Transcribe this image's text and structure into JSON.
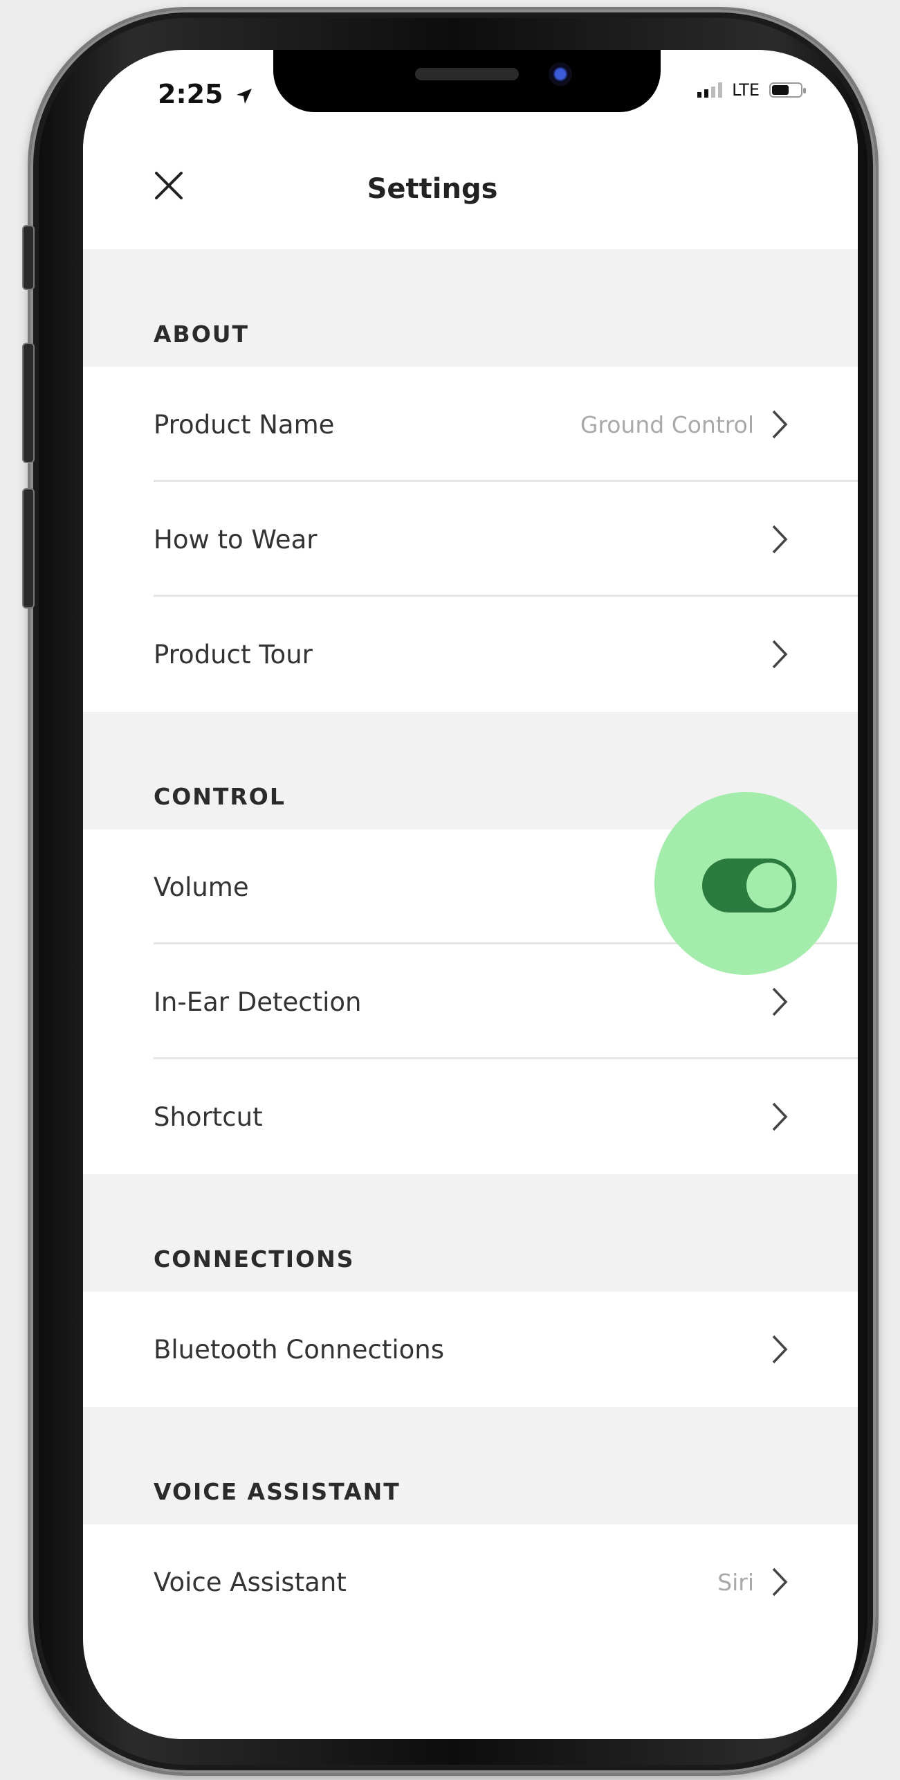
{
  "status_bar": {
    "time": "2:25",
    "network": "LTE"
  },
  "nav": {
    "title": "Settings",
    "close_icon": "close-icon"
  },
  "sections": {
    "about": {
      "label": "ABOUT",
      "rows": [
        {
          "label": "Product Name",
          "value": "Ground Control"
        },
        {
          "label": "How to Wear"
        },
        {
          "label": "Product Tour"
        }
      ]
    },
    "control": {
      "label": "CONTROL",
      "rows": [
        {
          "label": "Volume",
          "toggle_on": true
        },
        {
          "label": "In-Ear Detection"
        },
        {
          "label": "Shortcut"
        }
      ]
    },
    "connections": {
      "label": "CONNECTIONS",
      "rows": [
        {
          "label": "Bluetooth Connections"
        }
      ]
    },
    "voice_assistant": {
      "label": "VOICE ASSISTANT",
      "rows": [
        {
          "label": "Voice Assistant",
          "value": "Siri"
        }
      ]
    }
  },
  "colors": {
    "toggle_track": "#2b7a3e",
    "toggle_highlight": "#a3ecab",
    "section_bg": "#f2f2f2"
  }
}
